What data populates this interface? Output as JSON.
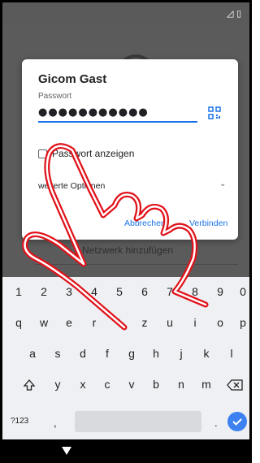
{
  "background": {
    "add_network_label": "Netzwerk hinzufügen"
  },
  "dialog": {
    "title": "Gicom Gast",
    "password_label": "Passwort",
    "password_value": "●●●●●●●●●●●",
    "show_password_label": "Passwort anzeigen",
    "show_password_checked": false,
    "advanced_label": "weiterte Optionen",
    "cancel_label": "Abbrechen",
    "connect_label": "Verbinden"
  },
  "keyboard": {
    "number_row": [
      "1",
      "2",
      "3",
      "4",
      "5",
      "6",
      "7",
      "8",
      "9",
      "0"
    ],
    "row1": [
      "q",
      "w",
      "e",
      "r",
      "t",
      "z",
      "u",
      "i",
      "o",
      "p"
    ],
    "row2": [
      "a",
      "s",
      "d",
      "f",
      "g",
      "h",
      "j",
      "k",
      "l"
    ],
    "row3": [
      "y",
      "x",
      "c",
      "v",
      "b",
      "n",
      "m"
    ],
    "symbols_label": "?123",
    "comma_label": ",",
    "period_label": ".",
    "accent_color": "#3d82f0"
  },
  "colors": {
    "dim_overlay": "#5b5b5b",
    "link_blue": "#1a73e8",
    "hand_red": "#e0121a"
  }
}
